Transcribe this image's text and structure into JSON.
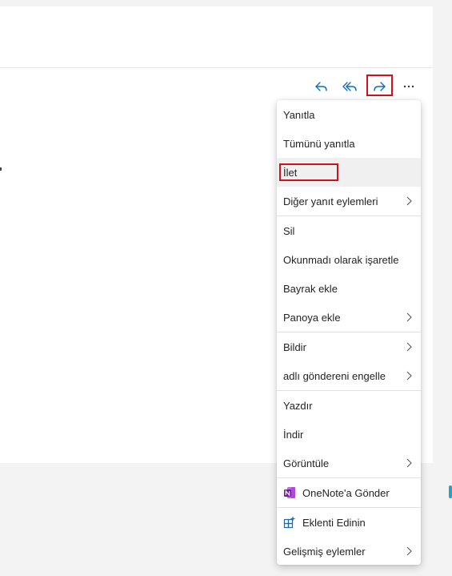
{
  "toolbar": {
    "reply_icon": "reply-icon",
    "reply_all_icon": "reply-all-icon",
    "forward_icon": "forward-icon",
    "more_icon": "more-icon",
    "icon_color": "#0f6cbd"
  },
  "menu": {
    "items": [
      {
        "label": "Yanıtla"
      },
      {
        "label": "Tümünü yanıtla"
      },
      {
        "label": "İlet"
      },
      {
        "label": "Diğer yanıt eylemleri"
      },
      {
        "label": "Sil"
      },
      {
        "label": "Okunmadı olarak işaretle"
      },
      {
        "label": "Bayrak ekle"
      },
      {
        "label": "Panoya ekle"
      },
      {
        "label": "Bildir"
      },
      {
        "label": "adlı göndereni engelle"
      },
      {
        "label": "Yazdır"
      },
      {
        "label": "İndir"
      },
      {
        "label": "Görüntüle"
      },
      {
        "label": "OneNote'a Gönder"
      },
      {
        "label": "Eklenti Edinin"
      },
      {
        "label": "Gelişmiş eylemler"
      }
    ]
  },
  "highlight_color": "#d0101b",
  "onenote_color": "#7719aa"
}
